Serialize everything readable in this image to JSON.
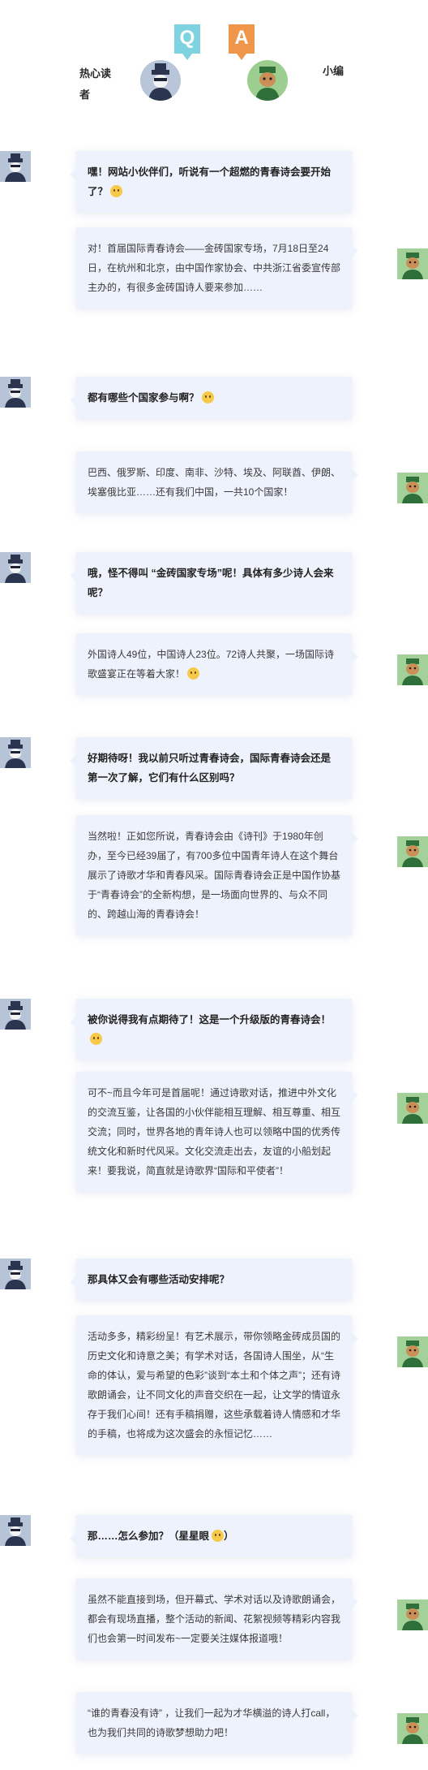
{
  "header": {
    "q_badge": "Q",
    "a_badge": "A",
    "reader_label": "热心读者",
    "editor_label": "小编"
  },
  "colors": {
    "bubble": "#edf2fc",
    "q_badge": "#7fd3e0",
    "a_badge": "#f0964a"
  },
  "messages": [
    {
      "role": "reader",
      "text": "嘿！网站小伙伴们，听说有一个超燃的青春诗会要开始了？",
      "emoji": "smile"
    },
    {
      "role": "editor",
      "text": "对！首届国际青春诗会——金砖国家专场，7月18日至24日，在杭州和北京，由中国作家协会、中共浙江省委宣传部主办的，有很多金砖国诗人要来参加……"
    },
    {
      "role": "reader",
      "text": "都有哪些个国家参与啊？",
      "emoji": "thinking"
    },
    {
      "role": "editor",
      "text": "巴西、俄罗斯、印度、南非、沙特、埃及、阿联酋、伊朗、埃塞俄比亚……还有我们中国，一共10个国家！"
    },
    {
      "role": "reader",
      "text": "哦，怪不得叫 “金砖国家专场”呢！具体有多少诗人会来呢？"
    },
    {
      "role": "editor",
      "text": "外国诗人49位，中国诗人23位。72诗人共聚，一场国际诗歌盛宴正在等着大家！",
      "emoji": "wink"
    },
    {
      "role": "reader",
      "text": "好期待呀！我以前只听过青春诗会，国际青春诗会还是第一次了解，它们有什么区别吗？"
    },
    {
      "role": "editor",
      "text": "当然啦！正如您所说，青春诗会由《诗刊》于1980年创办，至今已经39届了，有700多位中国青年诗人在这个舞台展示了诗歌才华和青春风采。国际青春诗会正是中国作协基于“青春诗会”的全新构想，是一场面向世界的、与众不同的、跨越山海的青春诗会！"
    },
    {
      "role": "reader",
      "text": "被你说得我有点期待了！这是一个升级版的青春诗会！",
      "emoji": "happy"
    },
    {
      "role": "editor",
      "text": "可不~而且今年可是首届呢！通过诗歌对话，推进中外文化的交流互鉴，让各国的小伙伴能相互理解、相互尊重、相互交流；同时，世界各地的青年诗人也可以领略中国的优秀传统文化和新时代风采。文化交流走出去，友谊的小船划起来！要我说，简直就是诗歌界“国际和平使者”！"
    },
    {
      "role": "reader",
      "text": "那具体又会有哪些活动安排呢？"
    },
    {
      "role": "editor",
      "text": "活动多多，精彩纷呈！有艺术展示，带你领略金砖成员国的历史文化和诗意之美；有学术对话，各国诗人围坐，从“生命的体认，爱与希望的色彩”谈到“本土和个体之声”；还有诗歌朗诵会，让不同文化的声音交织在一起，让文学的情谊永存于我们心间！还有手稿捐赠，这些承载着诗人情感和才华的手稿，也将成为这次盛会的永恒记忆……"
    },
    {
      "role": "reader",
      "text": "那……怎么参加？（星星眼",
      "emoji": "star-eyes",
      "suffix": "）"
    },
    {
      "role": "editor",
      "text": "虽然不能直接到场，但开幕式、学术对话以及诗歌朗诵会，都会有现场直播，整个活动的新闻、花絮视频等精彩内容我们也会第一时间发布~一定要关注媒体报道哦！"
    },
    {
      "role": "editor",
      "text": "“谁的青春没有诗” ，让我们一起为才华横溢的诗人打call，也为我们共同的诗歌梦想助力吧！"
    }
  ]
}
